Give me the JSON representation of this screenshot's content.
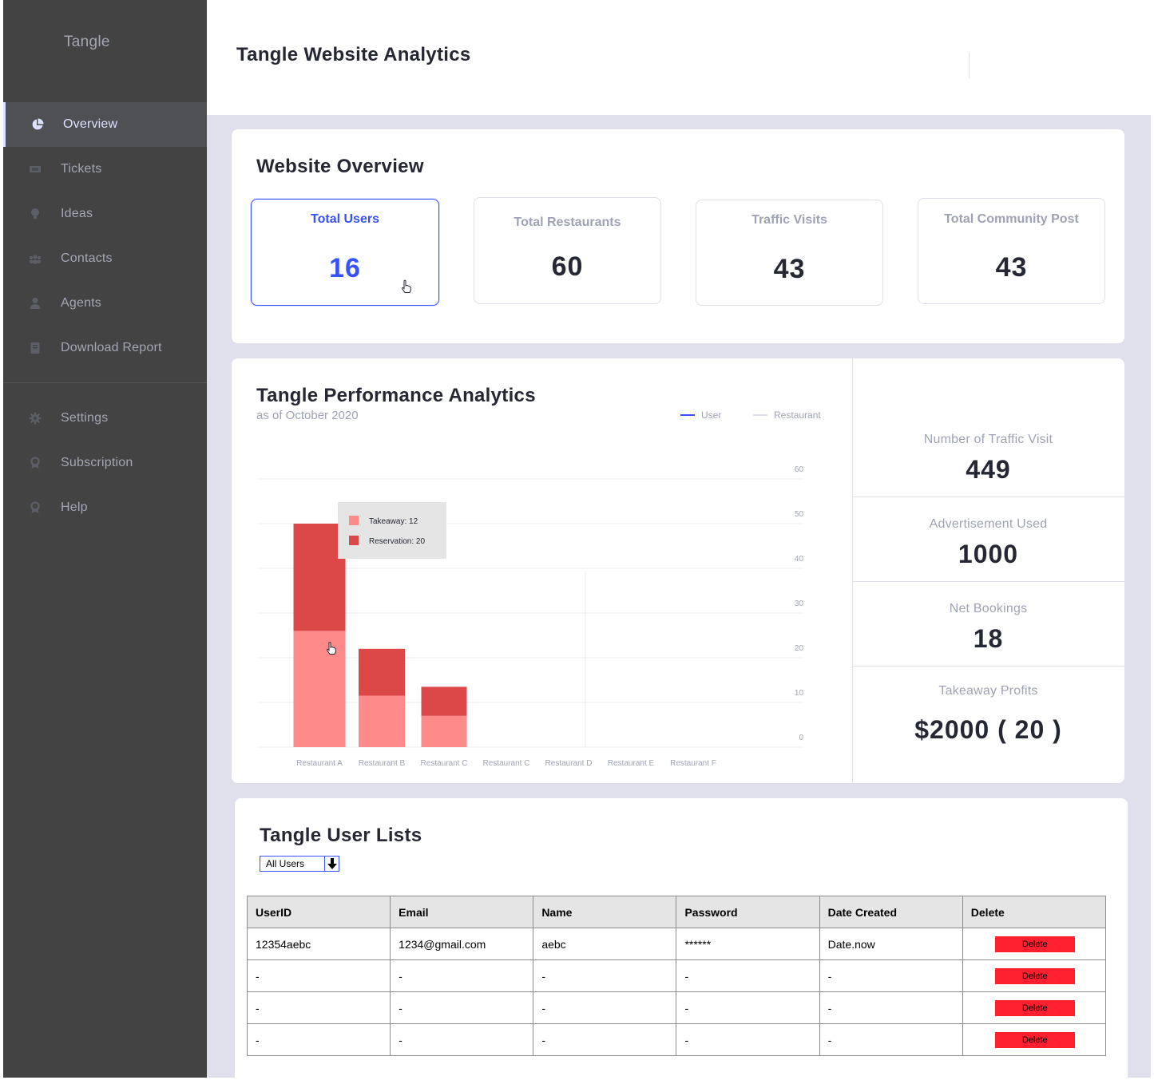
{
  "app": {
    "brand": "Tangle"
  },
  "sidebar": {
    "items": [
      {
        "label": "Overview",
        "icon": "pie-chart-icon",
        "active": true
      },
      {
        "label": "Tickets",
        "icon": "ticket-icon"
      },
      {
        "label": "Ideas",
        "icon": "lightbulb-icon"
      },
      {
        "label": "Contacts",
        "icon": "contacts-icon"
      },
      {
        "label": "Agents",
        "icon": "agent-icon"
      },
      {
        "label": "Download Report",
        "icon": "book-icon"
      }
    ],
    "bottom_items": [
      {
        "label": "Settings",
        "icon": "gear-icon"
      },
      {
        "label": "Subscription",
        "icon": "award-icon"
      },
      {
        "label": "Help",
        "icon": "award-icon"
      }
    ]
  },
  "header": {
    "title": "Tangle Website Analytics"
  },
  "overview": {
    "title": "Website Overview",
    "stats": [
      {
        "label": "Total Users",
        "value": "16",
        "active": true
      },
      {
        "label": "Total Restaurants",
        "value": "60"
      },
      {
        "label": "Traffic Visits",
        "value": "43"
      },
      {
        "label": "Total Community Post",
        "value": "43"
      }
    ]
  },
  "performance": {
    "title": "Tangle Performance Analytics",
    "subtitle": "as of October 2020",
    "legend": [
      {
        "name": "User",
        "color": "#3751ff"
      },
      {
        "name": "Restaurant",
        "color": "#dfe0eb"
      }
    ],
    "tooltip": {
      "takeaway": "Takeaway: 12",
      "reservation": "Reservation: 20"
    }
  },
  "chart_data": {
    "type": "bar",
    "stacked": true,
    "categories": [
      "Restaurant A",
      "Restaurant B",
      "Restaurant C",
      "Restaurant C",
      "Restaurant D",
      "Restaurant E",
      "Restaurant F"
    ],
    "series": [
      {
        "name": "Takeaway",
        "color": "#ff8a8a",
        "values": [
          26,
          11.5,
          7,
          0,
          0,
          0,
          0
        ]
      },
      {
        "name": "Reservation",
        "color": "#dc4848",
        "values": [
          24,
          10.5,
          6.5,
          0,
          0,
          0,
          0
        ]
      }
    ],
    "y_ticks": [
      0,
      10,
      20,
      30,
      40,
      50,
      60
    ],
    "ylim": [
      0,
      60
    ],
    "y_axis_side": "right",
    "grid": true
  },
  "kpis": [
    {
      "label": "Number of Traffic Visit",
      "value": "449"
    },
    {
      "label": "Advertisement Used",
      "value": "1000"
    },
    {
      "label": "Net Bookings",
      "value": "18"
    },
    {
      "label": "Takeaway Profits",
      "value": "$2000 ( 20 )"
    }
  ],
  "users": {
    "title": "Tangle User Lists",
    "filter": "All Users",
    "columns": [
      "UserID",
      "Email",
      "Name",
      "Password",
      "Date Created",
      "Delete"
    ],
    "rows": [
      [
        "12354aebc",
        "1234@gmail.com",
        "aebc",
        "******",
        "Date.now"
      ],
      [
        "-",
        "-",
        "-",
        "-",
        "-"
      ],
      [
        "-",
        "-",
        "-",
        "-",
        "-"
      ],
      [
        "-",
        "-",
        "-",
        "-",
        "-"
      ]
    ],
    "delete_label": "Delete",
    "delete_color": "#ff1f2e"
  }
}
